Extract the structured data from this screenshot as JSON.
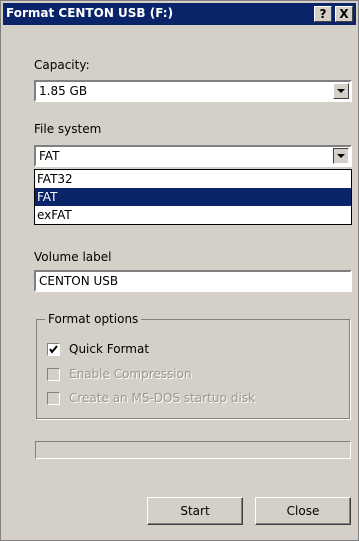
{
  "window": {
    "title": "Format CENTON USB (F:)",
    "help_label": "?",
    "close_label": "X"
  },
  "capacity": {
    "label": "Capacity:",
    "value": "1.85 GB"
  },
  "file_system": {
    "label": "File system",
    "value": "FAT",
    "options": [
      "FAT32",
      "FAT",
      "exFAT"
    ],
    "selected_index": 1
  },
  "volume_label": {
    "label": "Volume label",
    "value": "CENTON USB"
  },
  "format_options": {
    "legend": "Format options",
    "quick_format": {
      "label": "Quick Format",
      "checked": true,
      "enabled": true
    },
    "enable_compression": {
      "label": "Enable Compression",
      "checked": false,
      "enabled": false
    },
    "ms_dos_startup": {
      "label": "Create an MS-DOS startup disk",
      "checked": false,
      "enabled": false
    }
  },
  "progress": {
    "value": 0
  },
  "buttons": {
    "start": "Start",
    "close": "Close"
  },
  "colors": {
    "title_bar": "#0a246a",
    "dialog_face": "#d4d0c8",
    "selection": "#0a246a"
  }
}
